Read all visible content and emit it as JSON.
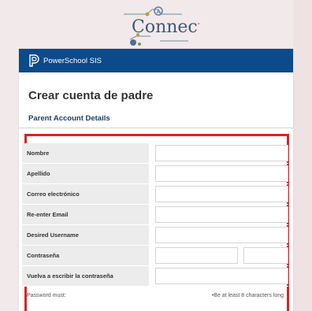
{
  "logo": {
    "text": "Connect",
    "icon": "connect-logo"
  },
  "app": {
    "name": "PowerSchool SIS",
    "brand_color": "#0b4a8b",
    "icon": "powerschool-icon"
  },
  "page_title": "Crear cuenta de padre",
  "section_title": "Parent Account Details",
  "fields": [
    {
      "label": "Nombre",
      "value": ""
    },
    {
      "label": "Apellido",
      "value": ""
    },
    {
      "label": "Correo electrónico",
      "value": ""
    },
    {
      "label": "Re-enter Email",
      "value": ""
    },
    {
      "label": "Desired Username",
      "value": ""
    },
    {
      "label": "Contraseña",
      "value": "",
      "value_confirm_segment": ""
    },
    {
      "label": "Vuelva a escribir la contraseña",
      "value": ""
    }
  ],
  "password_note": {
    "label": "Password must:",
    "rule": "•Be at least 8 characters long"
  },
  "highlight_color": "#e02020"
}
